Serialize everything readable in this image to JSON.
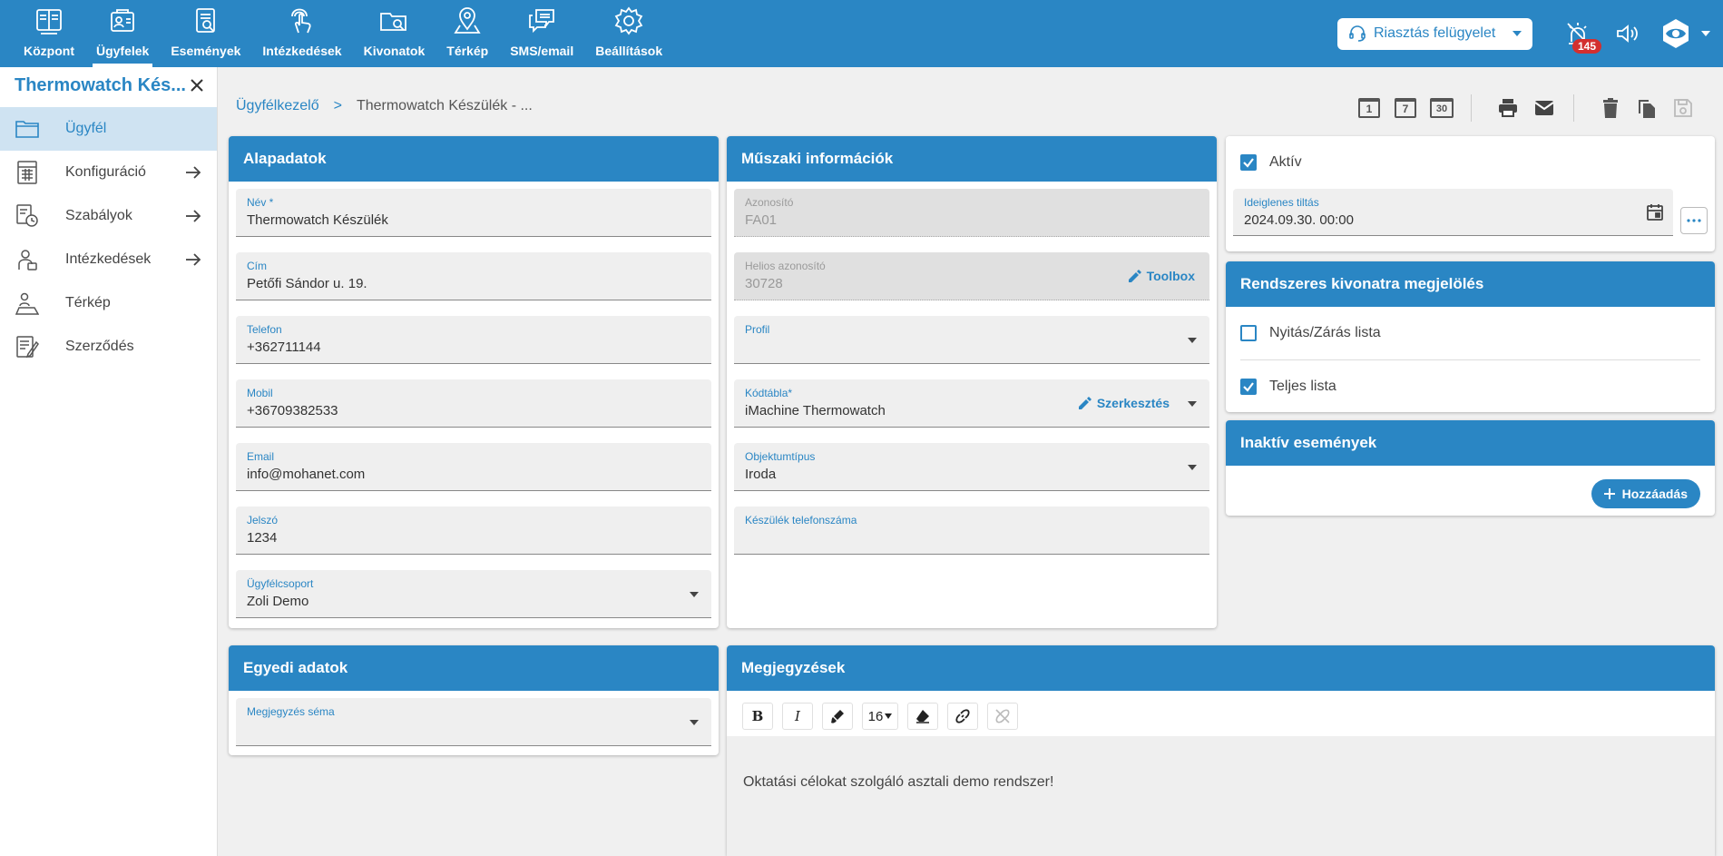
{
  "nav": {
    "items": [
      {
        "label": "Központ",
        "icon": "dashboard-icon"
      },
      {
        "label": "Ügyfelek",
        "icon": "clients-icon"
      },
      {
        "label": "Események",
        "icon": "events-icon"
      },
      {
        "label": "Intézkedések",
        "icon": "touch-icon"
      },
      {
        "label": "Kivonatok",
        "icon": "folder-search-icon"
      },
      {
        "label": "Térkép",
        "icon": "map-pin-icon"
      },
      {
        "label": "SMS/email",
        "icon": "chat-icon"
      },
      {
        "label": "Beállítások",
        "icon": "gear-icon"
      }
    ],
    "alarm_select": "Riasztás felügyelet",
    "badge_count": "145"
  },
  "sidebar": {
    "title": "Thermowatch Kés...",
    "items": [
      {
        "label": "Ügyfél"
      },
      {
        "label": "Konfiguráció"
      },
      {
        "label": "Szabályok"
      },
      {
        "label": "Intézkedések"
      },
      {
        "label": "Térkép"
      },
      {
        "label": "Szerződés"
      }
    ]
  },
  "breadcrumb": {
    "root": "Ügyfélkezelő",
    "separator": ">",
    "current": "Thermowatch Készülék - ..."
  },
  "toolbar": {
    "day1": "1",
    "day7": "7",
    "day30": "30"
  },
  "basic": {
    "title": "Alapadatok",
    "fields": [
      {
        "label": "Név *",
        "value": "Thermowatch Készülék"
      },
      {
        "label": "Cím",
        "value": "Petőfi Sándor u. 19."
      },
      {
        "label": "Telefon",
        "value": "+362711144"
      },
      {
        "label": "Mobil",
        "value": "+36709382533"
      },
      {
        "label": "Email",
        "value": "info@mohanet.com"
      },
      {
        "label": "Jelszó",
        "value": "1234"
      },
      {
        "label": "Ügyfélcsoport",
        "value": "Zoli Demo"
      }
    ]
  },
  "tech": {
    "title": "Műszaki információk",
    "fields": [
      {
        "label": "Azonosító",
        "value": "FA01"
      },
      {
        "label": "Helios azonosító",
        "value": "30728",
        "action": "Toolbox"
      },
      {
        "label": "Profil",
        "value": ""
      },
      {
        "label": "Kódtábla*",
        "value": "iMachine Thermowatch",
        "action": "Szerkesztés"
      },
      {
        "label": "Objektumtípus",
        "value": "Iroda"
      },
      {
        "label": "Készülék telefonszáma",
        "value": ""
      }
    ]
  },
  "status": {
    "active_label": "Aktív",
    "temp_ban_label": "Ideiglenes tiltás",
    "temp_ban_value": "2024.09.30. 00:00"
  },
  "extract": {
    "title": "Rendszeres kivonatra megjelölés",
    "open_close": "Nyitás/Zárás lista",
    "full_list": "Teljes lista"
  },
  "inactive": {
    "title": "Inaktív események",
    "add_label": "Hozzáadás"
  },
  "custom": {
    "title": "Egyedi adatok",
    "schema_label": "Megjegyzés séma"
  },
  "notes": {
    "title": "Megjegyzések",
    "font_size": "16",
    "text": "Oktatási célokat szolgáló asztali demo rendszer!"
  },
  "colors": {
    "primary": "#2a86c4",
    "badge": "#d32f2f"
  }
}
